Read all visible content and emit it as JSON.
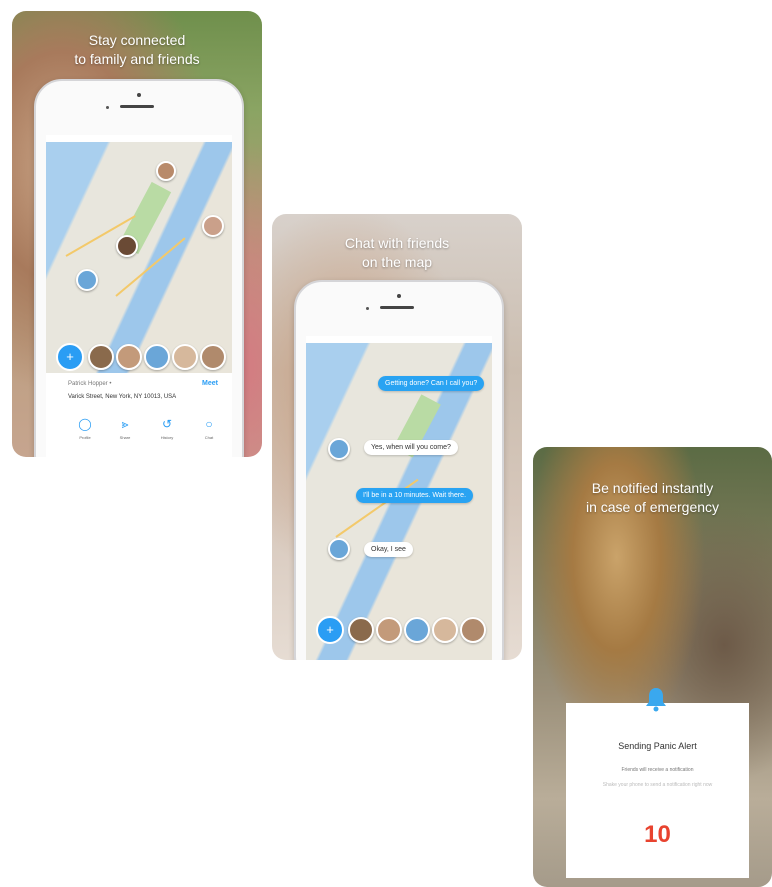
{
  "cards": [
    {
      "headline": [
        "Stay connected",
        "to family and friends"
      ],
      "info": {
        "name": "Patrick Hopper •",
        "action": "Meet",
        "address": "Varick Street, New York, NY 10013, USA"
      },
      "actions": [
        {
          "label": "Profile",
          "icon": "profile-icon"
        },
        {
          "label": "Share",
          "icon": "share-icon"
        },
        {
          "label": "History",
          "icon": "history-icon"
        },
        {
          "label": "Chat",
          "icon": "chat-icon"
        }
      ]
    },
    {
      "headline": [
        "Chat with friends",
        "on the map"
      ],
      "messages": [
        {
          "from": "me",
          "text": "Getting done? Can I call you?"
        },
        {
          "from": "them",
          "text": "Yes, when will you come?"
        },
        {
          "from": "me",
          "text": "I'll be in a 10 minutes. Wait there."
        },
        {
          "from": "them",
          "text": "Okay, I see"
        }
      ]
    },
    {
      "headline": [
        "Be notified instantly",
        "in case of emergency"
      ],
      "alert": {
        "title": "Sending Panic Alert",
        "subtitle": "Friends will receive a notification",
        "hint": "Shake your phone to send a notification right now",
        "countdown": "10"
      }
    }
  ],
  "colors": {
    "accent": "#2a9df4",
    "bubble_me": "#29a3f2",
    "alert_count": "#e8432f",
    "bell": "#3aa8ee"
  }
}
